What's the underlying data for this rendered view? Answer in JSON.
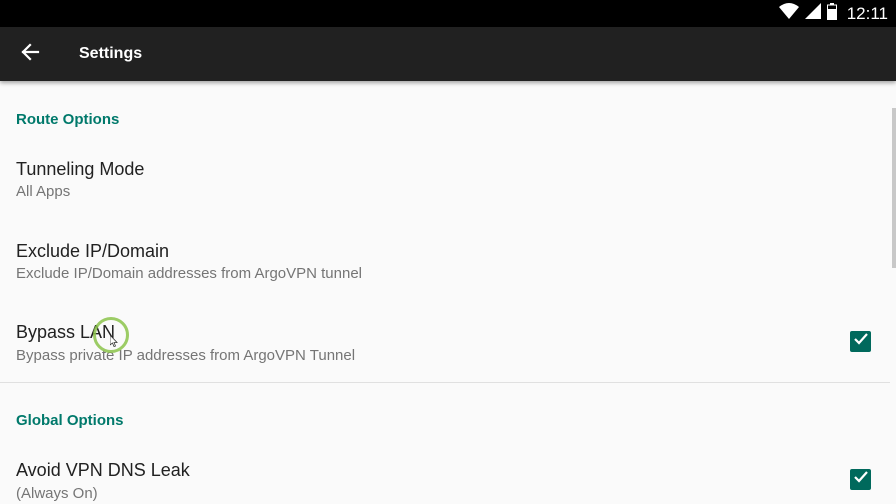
{
  "status_bar": {
    "time": "12:11",
    "icons": [
      "wifi-icon",
      "signal-icon",
      "battery-icon"
    ]
  },
  "toolbar": {
    "back_icon": "arrow-back-icon",
    "title": "Settings"
  },
  "sections": [
    {
      "header": "Route Options",
      "items": [
        {
          "title": "Tunneling Mode",
          "summary": "All Apps",
          "checkbox": null
        },
        {
          "title": "Exclude IP/Domain",
          "summary": "Exclude IP/Domain addresses from ArgoVPN tunnel",
          "checkbox": null
        },
        {
          "title": "Bypass LAN",
          "summary": "Bypass private IP addresses from ArgoVPN Tunnel",
          "checkbox": true
        }
      ]
    },
    {
      "header": "Global Options",
      "items": [
        {
          "title": "Avoid VPN DNS Leak",
          "summary": "(Always On)",
          "checkbox": true
        }
      ]
    }
  ],
  "colors": {
    "accent": "#00796b",
    "toolbar": "#212121",
    "status_bar": "#000000",
    "background": "#fafafa"
  }
}
